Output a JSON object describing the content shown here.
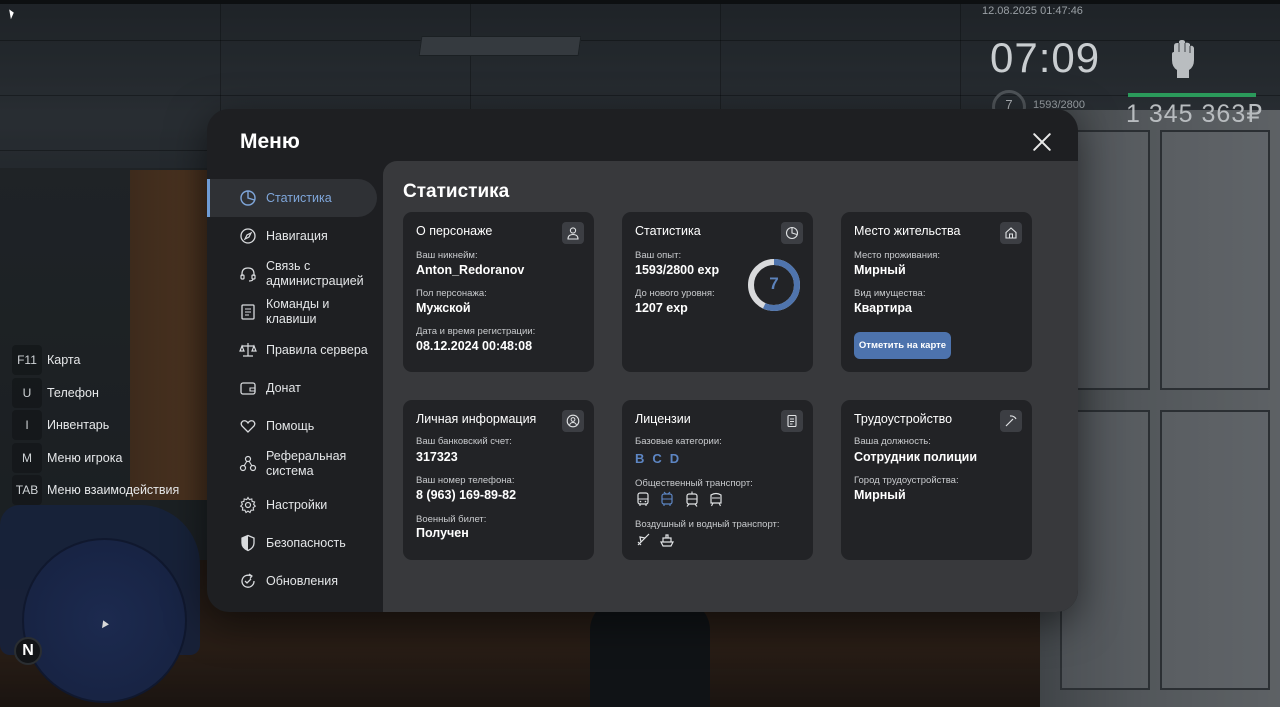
{
  "hud": {
    "datetime": "12.08.2025 01:47:46",
    "clock": "07:09",
    "level": "7",
    "exp": "1593/2800",
    "money": "1 345 363₽"
  },
  "hotkeys": [
    {
      "key": "F11",
      "label": "Карта"
    },
    {
      "key": "U",
      "label": "Телефон"
    },
    {
      "key": "I",
      "label": "Инвентарь"
    },
    {
      "key": "M",
      "label": "Меню игрока"
    },
    {
      "key": "TAB",
      "label": "Меню взаимодействия"
    }
  ],
  "minimap": {
    "compass": "N"
  },
  "menu": {
    "title": "Меню",
    "nav": [
      {
        "label": "Статистика",
        "icon": "pie-chart-icon",
        "active": true
      },
      {
        "label": "Навигация",
        "icon": "compass-icon"
      },
      {
        "label": "Связь с администрацией",
        "icon": "headset-icon"
      },
      {
        "label": "Команды и клавиши",
        "icon": "document-icon"
      },
      {
        "label": "Правила сервера",
        "icon": "scales-icon"
      },
      {
        "label": "Донат",
        "icon": "wallet-icon"
      },
      {
        "label": "Помощь",
        "icon": "heart-hands-icon"
      },
      {
        "label": "Реферальная система",
        "icon": "referral-icon"
      },
      {
        "label": "Настройки",
        "icon": "gear-icon"
      },
      {
        "label": "Безопасность",
        "icon": "shield-icon"
      },
      {
        "label": "Обновления",
        "icon": "refresh-check-icon"
      }
    ],
    "content_title": "Статистика",
    "cards": {
      "character": {
        "title": "О персонаже",
        "nickname_label": "Ваш никнейм:",
        "nickname": "Anton_Redoranov",
        "gender_label": "Пол персонажа:",
        "gender": "Мужской",
        "reg_label": "Дата и время регистрации:",
        "reg": "08.12.2024 00:48:08"
      },
      "stats": {
        "title": "Статистика",
        "exp_label": "Ваш опыт:",
        "exp": "1593/2800 exp",
        "next_label": "До нового уровня:",
        "next": "1207 exp",
        "level": "7",
        "progress": 0.569
      },
      "residence": {
        "title": "Место жительства",
        "place_label": "Место проживания:",
        "place": "Мирный",
        "property_label": "Вид имущества:",
        "property": "Квартира",
        "map_button": "Отметить на карте"
      },
      "personal": {
        "title": "Личная информация",
        "bank_label": "Ваш банковский счет:",
        "bank": "317323",
        "phone_label": "Ваш номер телефона:",
        "phone": "8 (963) 169-89-82",
        "military_label": "Военный билет:",
        "military": "Получен"
      },
      "licenses": {
        "title": "Лицензии",
        "basic_label": "Базовые категории:",
        "categories": [
          "B",
          "C",
          "D"
        ],
        "public_label": "Общественный транспорт:",
        "air_label": "Воздушный и водный транспорт:"
      },
      "employment": {
        "title": "Трудоустройство",
        "position_label": "Ваша должность:",
        "position": "Сотрудник полиции",
        "city_label": "Город трудоустройства:",
        "city": "Мирный"
      }
    }
  },
  "colors": {
    "accent": "#5d86c4",
    "button": "#4d73ad",
    "menu_bg": "#1e1f22",
    "content_bg": "#38393c",
    "card_bg": "#222326"
  }
}
